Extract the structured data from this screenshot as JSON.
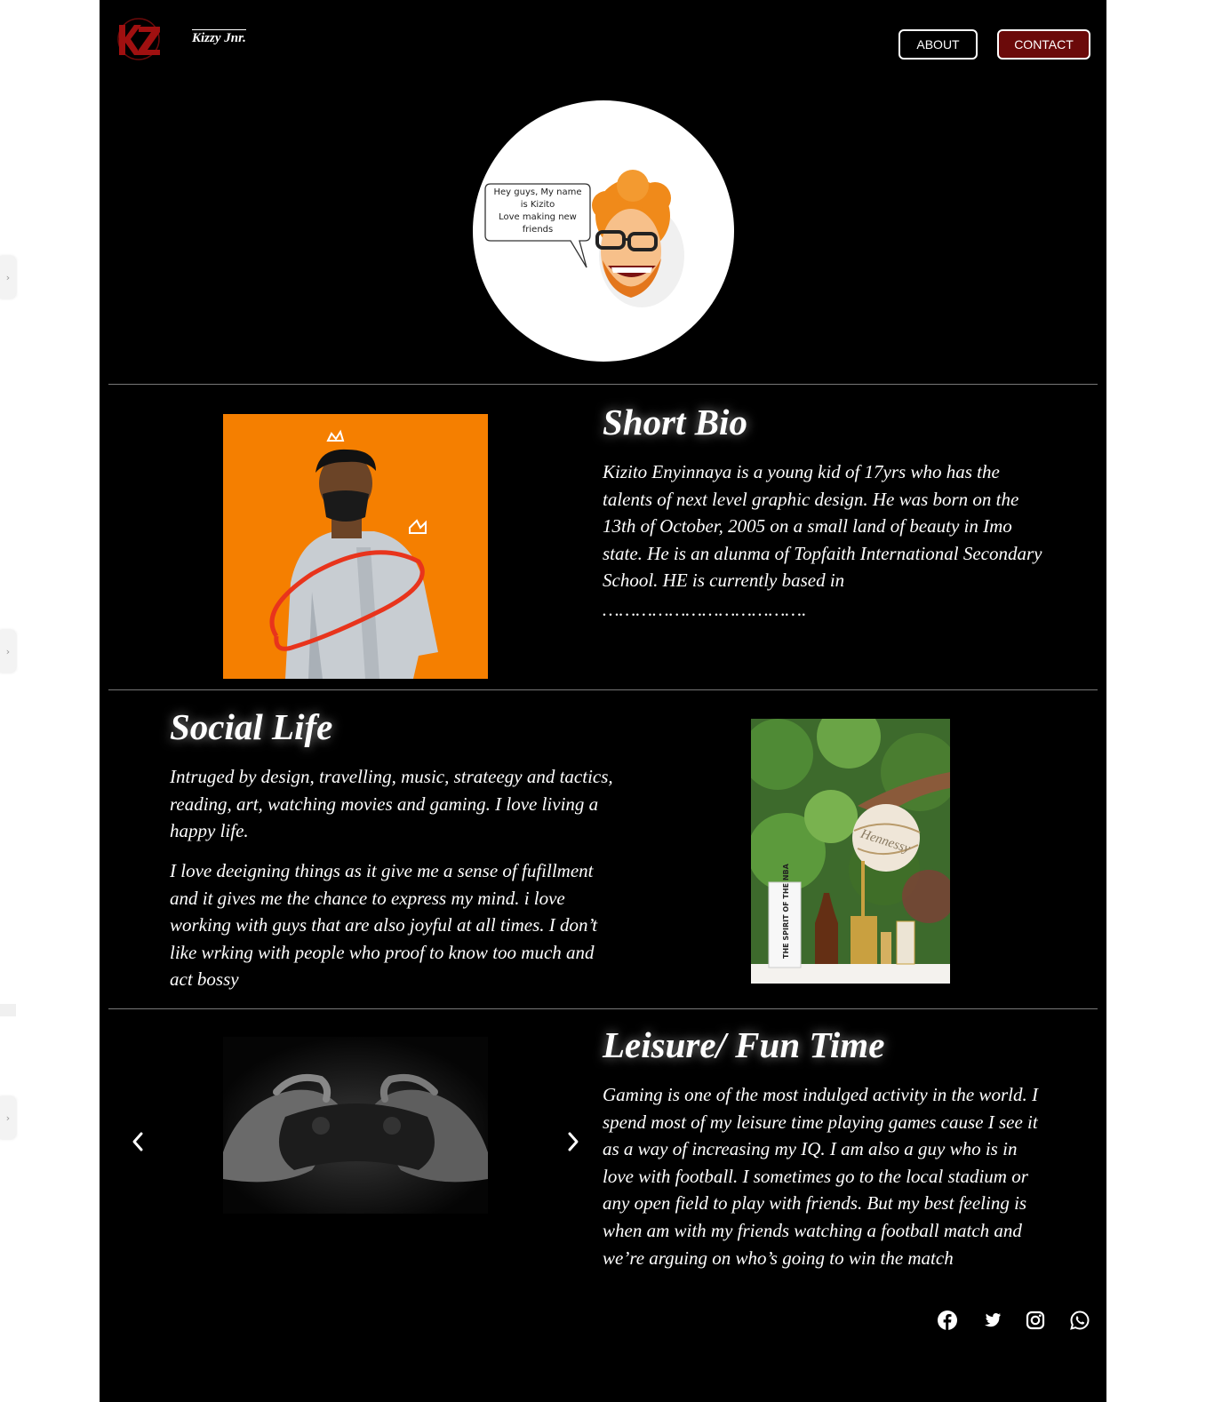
{
  "header": {
    "logo_text": "KZ",
    "brand": "Kizzy Jnr.",
    "nav": {
      "about": "ABOUT",
      "contact": "CONTACT"
    }
  },
  "avatar": {
    "speech_lines": [
      "Hey guys, My name",
      "is Kizito",
      "Love making new",
      "friends"
    ]
  },
  "bio": {
    "title": "Short Bio",
    "text": "Kizito Enyinnaya is a young kid of 17yrs who has the talents of next level graphic design. He was born on the 13th of October, 2005 on a small land of  beauty in Imo state. He is an alunma of Topfaith International Secondary School. HE is currently  based in",
    "dots": "………………………………."
  },
  "social_life": {
    "title": "Social Life",
    "p1": "Intruged by design, travelling, music, strateegy and tactics, reading, art, watching movies and gaming. I love living a happy life.",
    "p2": "I love deeigning things as it give me a sense of fufillment and it gives me the chance to express my mind. i love working with guys that are also joyful at all times. I don’t like wrking with people who proof to know too much and act bossy",
    "photo_labels": {
      "ball": "Hennessy",
      "box": "THE SPIRIT OF THE NBA"
    }
  },
  "leisure": {
    "title": "Leisure/ Fun Time",
    "text": "Gaming is one of the most indulged activity in the world. I spend most of my leisure time playing games cause I see it as a way of increasing my IQ. I am also a guy who is in love with football. I sometimes go to the local stadium or any open field to play with friends. But my best feeling is when am with my friends watching a football match and we’re arguing on who’s going to win the match"
  },
  "footer": {
    "social": [
      "facebook-icon",
      "twitter-icon",
      "instagram-icon",
      "whatsapp-icon"
    ]
  },
  "colors": {
    "accent": "#6b0a0a",
    "bio_bg": "#f57f00",
    "page_bg": "#000000"
  }
}
